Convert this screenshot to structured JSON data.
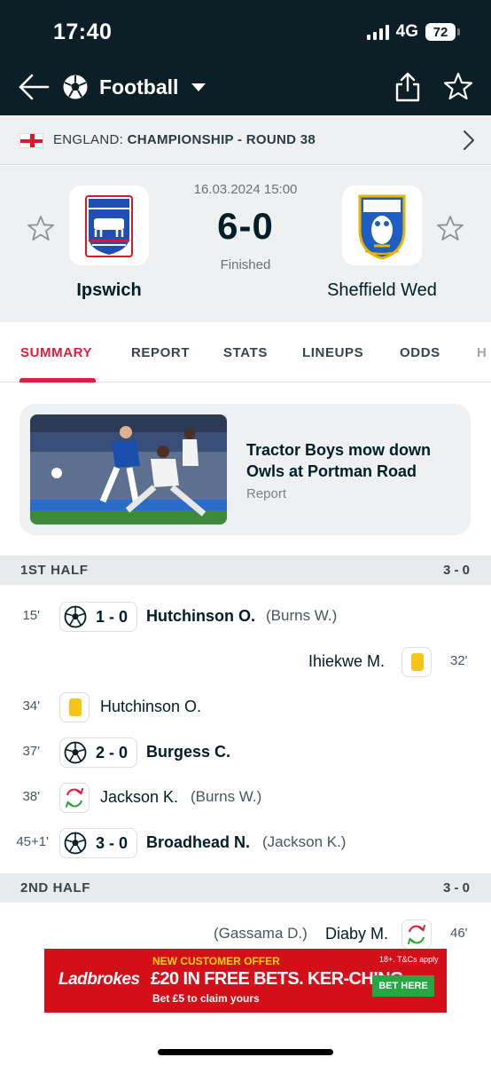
{
  "status": {
    "time": "17:40",
    "network": "4G",
    "battery": "72"
  },
  "header": {
    "sport": "Football"
  },
  "league": {
    "country": "ENGLAND:",
    "competition": "CHAMPIONSHIP - ROUND 38"
  },
  "match": {
    "date": "16.03.2024 15:00",
    "score": "6-0",
    "status": "Finished",
    "home": {
      "name": "Ipswich",
      "crest_label": "IPSWICH TOWN",
      "crest_color": "#1f4fb4"
    },
    "away": {
      "name": "Sheffield Wed",
      "crest_label": "SWFC",
      "crest_color": "#1c5ec4"
    }
  },
  "tabs": [
    "SUMMARY",
    "REPORT",
    "STATS",
    "LINEUPS",
    "ODDS",
    "H"
  ],
  "report": {
    "title": "Tractor Boys mow down Owls at Portman Road",
    "label": "Report"
  },
  "first_half": {
    "title": "1ST HALF",
    "score": "3 - 0",
    "events": [
      {
        "minute": "15'",
        "side": "home",
        "type": "goal",
        "score": "1 - 0",
        "player": "Hutchinson O.",
        "assist": "(Burns W.)"
      },
      {
        "minute": "32'",
        "side": "away",
        "type": "yellow",
        "player": "Ihiekwe M."
      },
      {
        "minute": "34'",
        "side": "home",
        "type": "yellow",
        "player": "Hutchinson O."
      },
      {
        "minute": "37'",
        "side": "home",
        "type": "goal",
        "score": "2 - 0",
        "player": "Burgess C."
      },
      {
        "minute": "38'",
        "side": "home",
        "type": "sub",
        "player": "Jackson K.",
        "assist": "(Burns W.)"
      },
      {
        "minute": "45+1'",
        "side": "home",
        "type": "goal",
        "score": "3 - 0",
        "player": "Broadhead N.",
        "assist": "(Jackson K.)"
      }
    ]
  },
  "second_half": {
    "title": "2ND HALF",
    "score": "3 - 0",
    "events": [
      {
        "minute": "46'",
        "side": "away",
        "type": "sub",
        "player": "Diaby M.",
        "assist": "(Gassama D.)"
      }
    ]
  },
  "ad": {
    "brand": "Ladbrokes",
    "offer": "NEW CUSTOMER OFFER",
    "headline": "£20 IN FREE BETS. KER-CHING.",
    "sub": "Bet £5 to claim yours",
    "tcs": "18+. T&Cs apply",
    "cta": "BET HERE"
  },
  "colors": {
    "accent": "#dd1d3a",
    "header_bg": "#0d1f26",
    "yellow_card": "#f5c518",
    "sub_in": "#2aa63a",
    "sub_out": "#dd1d3a"
  }
}
